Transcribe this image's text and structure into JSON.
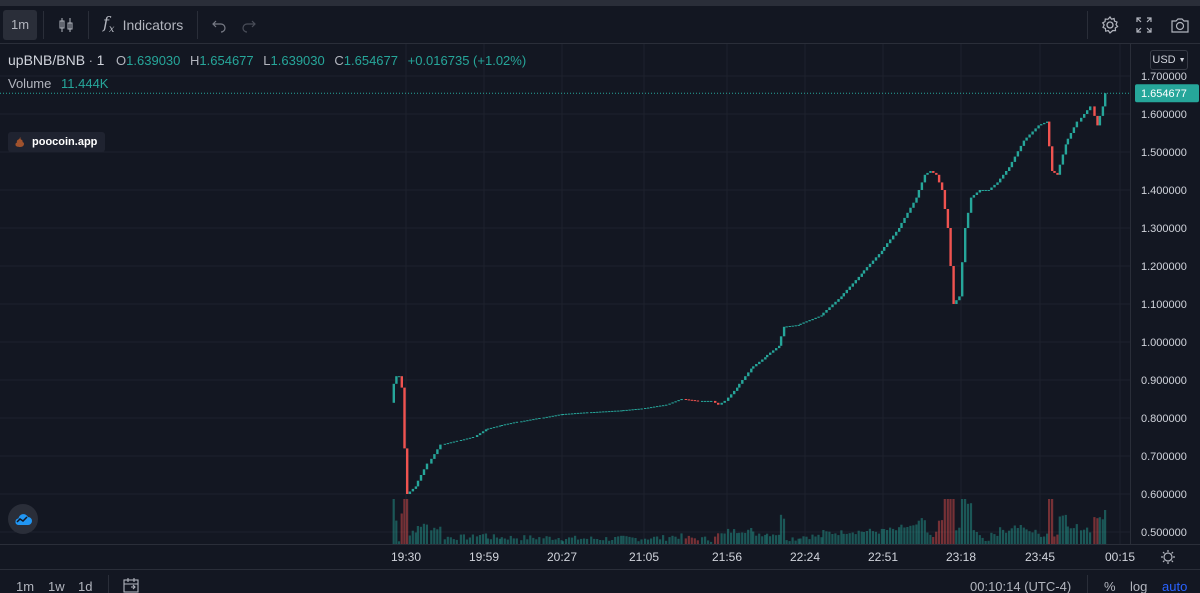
{
  "toolbar": {
    "interval": "1m",
    "indicators_label": "Indicators"
  },
  "legend": {
    "symbol": "upBNB/BNB",
    "interval": "1",
    "o_key": "O",
    "o_val": "1.639030",
    "h_key": "H",
    "h_val": "1.654677",
    "l_key": "L",
    "l_val": "1.639030",
    "c_key": "C",
    "c_val": "1.654677",
    "change": "+0.016735 (+1.02%)",
    "volume_key": "Volume",
    "volume_val": "11.444K"
  },
  "watermark": {
    "text": "poocoin.app"
  },
  "currency": "USD",
  "bottombar": {
    "ranges": [
      "1m",
      "1w",
      "1d"
    ],
    "time": "00:10:14 (UTC-4)",
    "percent": "%",
    "log": "log",
    "auto": "auto"
  },
  "colors": {
    "background": "#131722",
    "up": "#26a69a",
    "down": "#ef5350",
    "grid": "#1e222d",
    "text": "#d1d4dc"
  },
  "chart_data": {
    "type": "line",
    "price_ticks": [
      "1.700000",
      "1.600000",
      "1.500000",
      "1.400000",
      "1.300000",
      "1.200000",
      "1.100000",
      "1.000000",
      "0.900000",
      "0.800000",
      "0.700000",
      "0.600000",
      "0.500000"
    ],
    "ylim": [
      0.5,
      1.7
    ],
    "last_price": "1.654677",
    "time_ticks": [
      "19:30",
      "19:59",
      "20:27",
      "21:05",
      "21:56",
      "22:24",
      "22:51",
      "23:18",
      "23:45",
      "00:15"
    ],
    "series": [
      {
        "values": [
          [
            "19:25",
            0.84
          ],
          [
            "19:26",
            0.89
          ],
          [
            "19:27",
            0.91
          ],
          [
            "19:28",
            0.91
          ],
          [
            "19:29",
            0.88
          ],
          [
            "19:30",
            0.72
          ],
          [
            "19:31",
            0.6
          ],
          [
            "19:34",
            0.62
          ],
          [
            "19:39",
            0.68
          ],
          [
            "19:44",
            0.73
          ],
          [
            "19:50",
            0.74
          ],
          [
            "19:56",
            0.75
          ],
          [
            "20:00",
            0.77
          ],
          [
            "20:05",
            0.78
          ],
          [
            "20:12",
            0.79
          ],
          [
            "20:20",
            0.8
          ],
          [
            "20:27",
            0.81
          ],
          [
            "20:40",
            0.815
          ],
          [
            "20:55",
            0.82
          ],
          [
            "21:05",
            0.825
          ],
          [
            "21:20",
            0.835
          ],
          [
            "21:30",
            0.85
          ],
          [
            "21:40",
            0.845
          ],
          [
            "21:48",
            0.845
          ],
          [
            "21:52",
            0.835
          ],
          [
            "21:56",
            0.845
          ],
          [
            "22:00",
            0.88
          ],
          [
            "22:05",
            0.93
          ],
          [
            "22:10",
            0.96
          ],
          [
            "22:15",
            0.99
          ],
          [
            "22:17",
            1.04
          ],
          [
            "22:22",
            1.045
          ],
          [
            "22:30",
            1.07
          ],
          [
            "22:37",
            1.12
          ],
          [
            "22:44",
            1.18
          ],
          [
            "22:51",
            1.24
          ],
          [
            "22:57",
            1.3
          ],
          [
            "23:03",
            1.38
          ],
          [
            "23:06",
            1.44
          ],
          [
            "23:08",
            1.45
          ],
          [
            "23:10",
            1.44
          ],
          [
            "23:12",
            1.4
          ],
          [
            "23:14",
            1.3
          ],
          [
            "23:16",
            1.1
          ],
          [
            "23:18",
            1.12
          ],
          [
            "23:20",
            1.3
          ],
          [
            "23:22",
            1.38
          ],
          [
            "23:25",
            1.4
          ],
          [
            "23:28",
            1.4
          ],
          [
            "23:31",
            1.42
          ],
          [
            "23:35",
            1.46
          ],
          [
            "23:40",
            1.53
          ],
          [
            "23:45",
            1.57
          ],
          [
            "23:48",
            1.58
          ],
          [
            "23:50",
            1.45
          ],
          [
            "23:52",
            1.44
          ],
          [
            "23:55",
            1.52
          ],
          [
            "00:00",
            1.58
          ],
          [
            "00:05",
            1.62
          ],
          [
            "00:07",
            1.57
          ],
          [
            "00:09",
            1.62
          ],
          [
            "00:10",
            1.654677
          ]
        ]
      }
    ]
  }
}
